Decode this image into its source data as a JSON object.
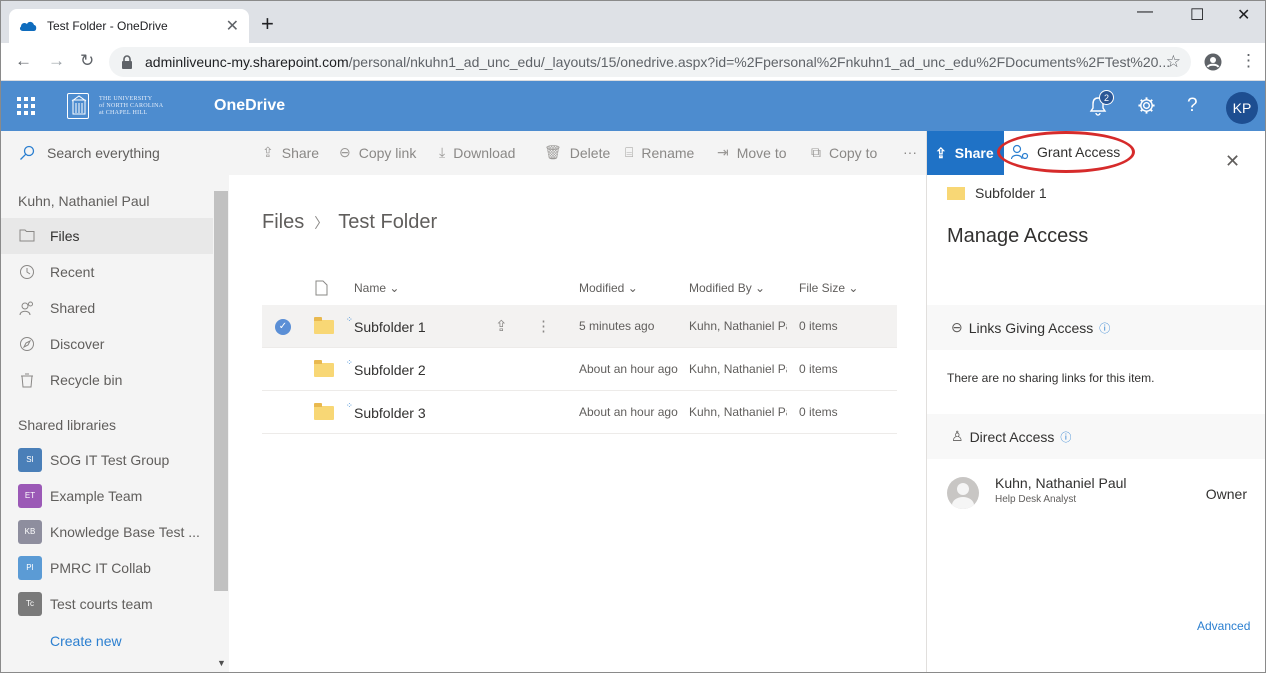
{
  "browser": {
    "tab_title": "Test Folder - OneDrive",
    "tab_close": "✕",
    "new_tab": "+",
    "url_host": "adminliveunc-my.sharepoint.com",
    "url_path": "/personal/nkuhn1_ad_unc_edu/_layouts/15/onedrive.aspx?id=%2Fpersonal%2Fnkuhn1_ad_unc_edu%2FDocuments%2FTest%20..."
  },
  "suite": {
    "app_name": "OneDrive",
    "org_logo_lines": [
      "THE UNIVERSITY",
      "of NORTH CAROLINA",
      "at CHAPEL HILL"
    ],
    "notification_count": "2",
    "user_initials": "KP",
    "brand_color": "#4d8ccf"
  },
  "leftnav": {
    "search_placeholder": "Search everything",
    "user_name": "Kuhn, Nathaniel Paul",
    "items": [
      {
        "label": "Files",
        "icon": "folder-icon"
      },
      {
        "label": "Recent",
        "icon": "clock-icon"
      },
      {
        "label": "Shared",
        "icon": "people-icon"
      },
      {
        "label": "Discover",
        "icon": "compass-icon"
      },
      {
        "label": "Recycle bin",
        "icon": "trash-icon"
      }
    ],
    "shared_libraries_header": "Shared libraries",
    "libraries": [
      {
        "label": "SOG IT Test Group",
        "chip": "SI",
        "color": "#4a7fb8"
      },
      {
        "label": "Example Team",
        "chip": "ET",
        "color": "#9b59b6"
      },
      {
        "label": "Knowledge Base Test ...",
        "chip": "KB",
        "color": "#8e8e9e"
      },
      {
        "label": "PMRC IT Collab",
        "chip": "PI",
        "color": "#5b9bd5"
      },
      {
        "label": "Test courts team",
        "chip": "Tc",
        "color": "#7a7a7a"
      }
    ],
    "create_new": "Create new"
  },
  "commands": {
    "share": "Share",
    "copy_link": "Copy link",
    "download": "Download",
    "delete": "Delete",
    "rename": "Rename",
    "move_to": "Move to",
    "copy_to": "Copy to",
    "more": "···"
  },
  "main": {
    "breadcrumb_root": "Files",
    "breadcrumb_current": "Test Folder",
    "columns": {
      "name": "Name",
      "modified": "Modified",
      "modified_by": "Modified By",
      "file_size": "File Size"
    },
    "rows": [
      {
        "name": "Subfolder 1",
        "modified": "5 minutes ago",
        "modified_by": "Kuhn, Nathaniel Pa",
        "size": "0 items"
      },
      {
        "name": "Subfolder 2",
        "modified": "About an hour ago",
        "modified_by": "Kuhn, Nathaniel Pa",
        "size": "0 items"
      },
      {
        "name": "Subfolder 3",
        "modified": "About an hour ago",
        "modified_by": "Kuhn, Nathaniel Pa",
        "size": "0 items"
      }
    ]
  },
  "panel": {
    "share_tab": "Share",
    "grant_access_tab": "Grant Access",
    "item_name": "Subfolder 1",
    "title": "Manage Access",
    "links_section": "Links Giving Access",
    "no_links": "There are no sharing links for this item.",
    "direct_section": "Direct Access",
    "person_name": "Kuhn, Nathaniel Paul",
    "person_title": "Help Desk Analyst",
    "person_role": "Owner",
    "advanced": "Advanced",
    "highlight_color": "#d62b2b"
  }
}
